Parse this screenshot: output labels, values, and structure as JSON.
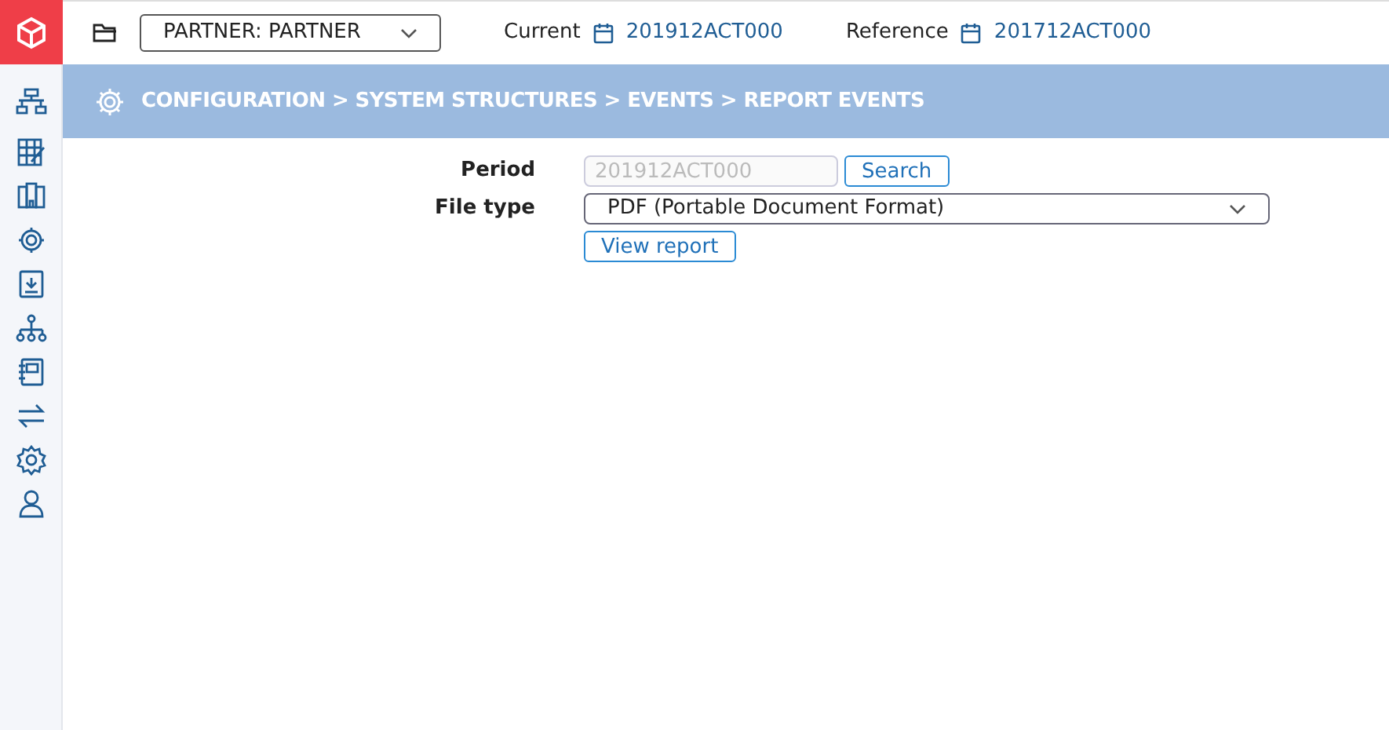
{
  "header": {
    "partner_select": {
      "value": "PARTNER: PARTNER"
    },
    "current": {
      "label": "Current",
      "value": "201912ACT000"
    },
    "reference": {
      "label": "Reference",
      "value": "201712ACT000"
    }
  },
  "breadcrumb": "CONFIGURATION > SYSTEM STRUCTURES > EVENTS > REPORT EVENTS",
  "form": {
    "period": {
      "label": "Period",
      "placeholder": "201912ACT000",
      "button": "Search"
    },
    "file_type": {
      "label": "File type",
      "value": "PDF (Portable Document Format)"
    },
    "button": "View report"
  }
}
